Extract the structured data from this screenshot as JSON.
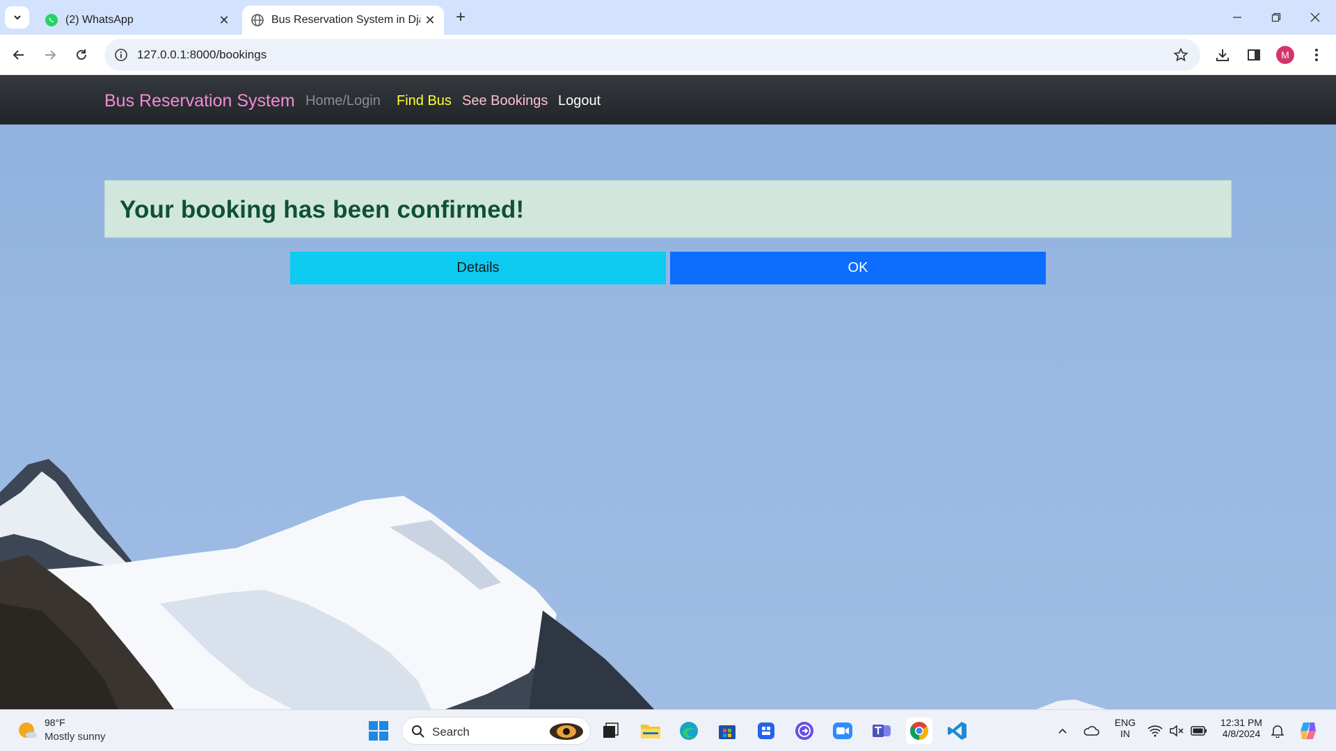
{
  "browser": {
    "tabs": [
      {
        "title": "(2) WhatsApp"
      },
      {
        "title": "Bus Reservation System in Django"
      }
    ],
    "url": "127.0.0.1:8000/bookings",
    "avatar_letter": "M"
  },
  "site": {
    "brand": "Bus Reservation System",
    "nav": {
      "home": "Home/Login",
      "find_bus": "Find Bus",
      "see_bookings": "See Bookings",
      "logout": "Logout"
    },
    "alert_message": "Your booking has been confirmed!",
    "buttons": {
      "details": "Details",
      "ok": "OK"
    },
    "colors": {
      "brand": "#f38bd6",
      "find_bus": "#ffff33",
      "see_bookings": "#ffc0cb",
      "alert_bg": "#d1e7dd",
      "details_btn": "#0dcaf0",
      "ok_btn": "#0d6efd"
    }
  },
  "taskbar": {
    "weather": {
      "temp": "98°F",
      "desc": "Mostly sunny"
    },
    "search_label": "Search",
    "language": {
      "line1": "ENG",
      "line2": "IN"
    },
    "clock": {
      "time": "12:31 PM",
      "date": "4/8/2024"
    }
  }
}
